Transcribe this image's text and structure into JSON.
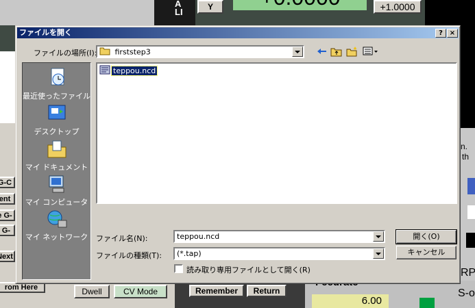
{
  "background": {
    "axis_button": "Y",
    "axis_letters": "ALI",
    "dro_value": "+0.0000",
    "scale_value": "+1.0000",
    "left_tabs": [
      "G-C",
      "ent",
      "e G-",
      "G-",
      "Next",
      "rom Here"
    ],
    "dwell": "Dwell",
    "cv_mode": "CV Mode",
    "remember": "Remember",
    "return": "Return",
    "feedrate_label": "Feedrate",
    "feedrate_value": "6.00",
    "right_frag_1": "n.",
    "right_frag_2": "th",
    "right_frag_3": "RP",
    "right_frag_4": "S-o"
  },
  "dialog": {
    "title": "ファイルを開く",
    "help_btn": "?",
    "close_btn": "×",
    "look_in_label": "ファイルの場所(I):",
    "look_in_value": "firststep3",
    "places": [
      {
        "label": "最近使ったファイル",
        "icon": "recent-icon"
      },
      {
        "label": "デスクトップ",
        "icon": "desktop-icon"
      },
      {
        "label": "マイ ドキュメント",
        "icon": "my-documents-icon"
      },
      {
        "label": "マイ コンピュータ",
        "icon": "my-computer-icon"
      },
      {
        "label": "マイ ネットワーク",
        "icon": "my-network-icon"
      }
    ],
    "files": [
      {
        "name": "teppou.ncd",
        "icon": "nc-file-icon"
      }
    ],
    "filename_label": "ファイル名(N):",
    "filename_value": "teppou.ncd",
    "filetype_label": "ファイルの種類(T):",
    "filetype_value": "(*.tap)",
    "readonly_label": "読み取り専用ファイルとして開く(R)",
    "open_btn": "開く(O)",
    "cancel_btn": "キャンセル"
  },
  "colors": {
    "title_start": "#0a246a",
    "title_end": "#a6caf0",
    "face": "#d4d0c8"
  }
}
